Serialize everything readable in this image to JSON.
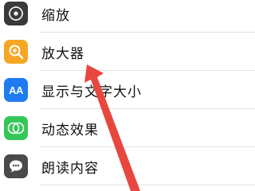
{
  "settings_list": {
    "items": [
      {
        "label": "缩放",
        "icon": "zoom-target-icon",
        "color": "#3a3a3c"
      },
      {
        "label": "放大器",
        "icon": "magnifier-icon",
        "color": "#f5a623"
      },
      {
        "label": "显示与文字大小",
        "icon": "text-size-aa-icon",
        "color": "#1e7cf2"
      },
      {
        "label": "动态效果",
        "icon": "motion-circles-icon",
        "color": "#34c759"
      },
      {
        "label": "朗读内容",
        "icon": "speech-bubble-icon",
        "color": "#4a4a4c"
      }
    ],
    "icon_text_aa": "AA"
  },
  "annotation": {
    "color": "#e8473f"
  }
}
